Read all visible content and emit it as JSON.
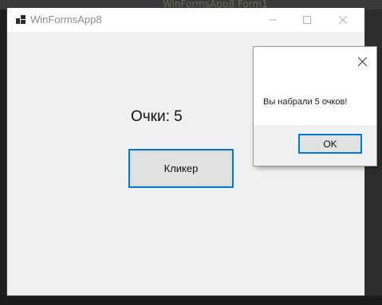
{
  "background": {
    "tab_text": "WinFormsApp8 Form1"
  },
  "window": {
    "title": "WinFormsApp8",
    "icon": "app-icon",
    "controls": {
      "minimize_icon": "minimize-icon",
      "maximize_icon": "maximize-icon",
      "close_icon": "close-icon"
    }
  },
  "main": {
    "score_label": "Очки: 5",
    "clicker_button_label": "Кликер"
  },
  "message_box": {
    "close_icon": "close-icon",
    "text": "Вы набрали 5 очков!",
    "ok_label": "OK"
  },
  "colors": {
    "accent": "#0078d7",
    "window_bg": "#f0f0f0",
    "titlebar_bg": "#ffffff",
    "button_bg": "#e1e1e1"
  }
}
